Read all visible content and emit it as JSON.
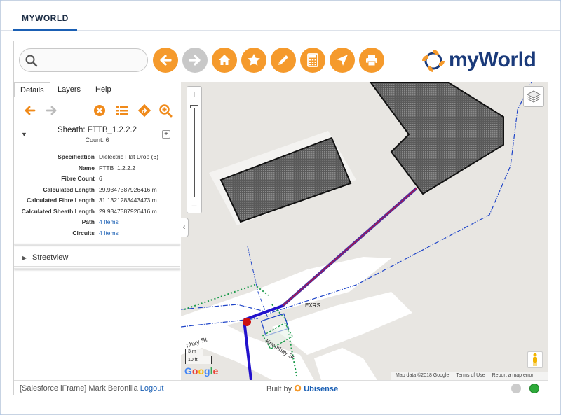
{
  "tab": {
    "label": "MYWORLD"
  },
  "search": {
    "value": "",
    "placeholder": ""
  },
  "toolbar": {
    "buttons": [
      "back-icon",
      "forward-icon",
      "home-icon",
      "bookmark-star-icon",
      "edit-pencil-icon",
      "calculator-icon",
      "locate-arrow-icon",
      "print-icon"
    ],
    "accent": "#f59a2c",
    "disabled": "#c8c8c8"
  },
  "logo": {
    "text": "myWorld",
    "color": "#1a3a7a"
  },
  "panel": {
    "tabs": [
      "Details",
      "Layers",
      "Help"
    ],
    "active_tab": "Details",
    "feature": {
      "title": "Sheath: FTTB_1.2.2.2",
      "count": "Count: 6"
    },
    "properties": [
      {
        "key": "Specification",
        "value": "Dielectric Flat Drop (6)",
        "link": false
      },
      {
        "key": "Name",
        "value": "FTTB_1.2.2.2",
        "link": false
      },
      {
        "key": "Fibre Count",
        "value": "6",
        "link": false
      },
      {
        "key": "Calculated Length",
        "value": "29.9347387926416 m",
        "link": false
      },
      {
        "key": "Calculated Fibre Length",
        "value": "31.1321283443473 m",
        "link": false
      },
      {
        "key": "Calculated Sheath Length",
        "value": "29.9347387926416 m",
        "link": false
      },
      {
        "key": "Path",
        "value": "4 Items",
        "link": true
      },
      {
        "key": "Circuits",
        "value": "4 Items",
        "link": true
      }
    ],
    "streetview": "Streetview"
  },
  "map": {
    "labels": {
      "exrs": "EXRS",
      "street1": "nhay St",
      "street2": "Kriemhay St"
    },
    "scale": {
      "metric": "3 m",
      "imperial": "10 ft"
    },
    "google_logo": "Google",
    "attribution": {
      "data": "Map data ©2018 Google",
      "terms": "Terms of Use",
      "report": "Report a map error"
    },
    "zoom_in": "+",
    "zoom_out": "−",
    "collapse": "‹"
  },
  "footer": {
    "frame": "[Salesforce iFrame] Mark Beronilla",
    "logout": "Logout",
    "built_by": "Built by",
    "ubisense": "Ubisense"
  }
}
